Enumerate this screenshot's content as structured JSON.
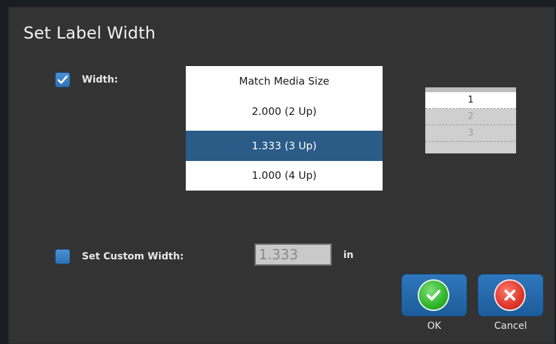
{
  "dialog": {
    "title": "Set Label Width"
  },
  "width_option": {
    "checked": true,
    "label": "Width:"
  },
  "width_list": {
    "items": [
      {
        "label": "Match Media Size",
        "selected": false
      },
      {
        "label": "2.000 (2 Up)",
        "selected": false
      },
      {
        "label": "1.333 (3 Up)",
        "selected": true
      },
      {
        "label": "1.000 (4 Up)",
        "selected": false
      }
    ]
  },
  "spinner": {
    "rows": [
      "1",
      "2",
      "3"
    ],
    "active_index": 0
  },
  "custom_width": {
    "checked": false,
    "label": "Set Custom Width:",
    "value": "1.333",
    "unit": "in"
  },
  "buttons": {
    "ok_label": "OK",
    "cancel_label": "Cancel"
  },
  "colors": {
    "dialog_bg": "#333333",
    "accent_blue": "#2b5b87",
    "ok_green": "#2fb52a",
    "cancel_red": "#e0362a"
  }
}
